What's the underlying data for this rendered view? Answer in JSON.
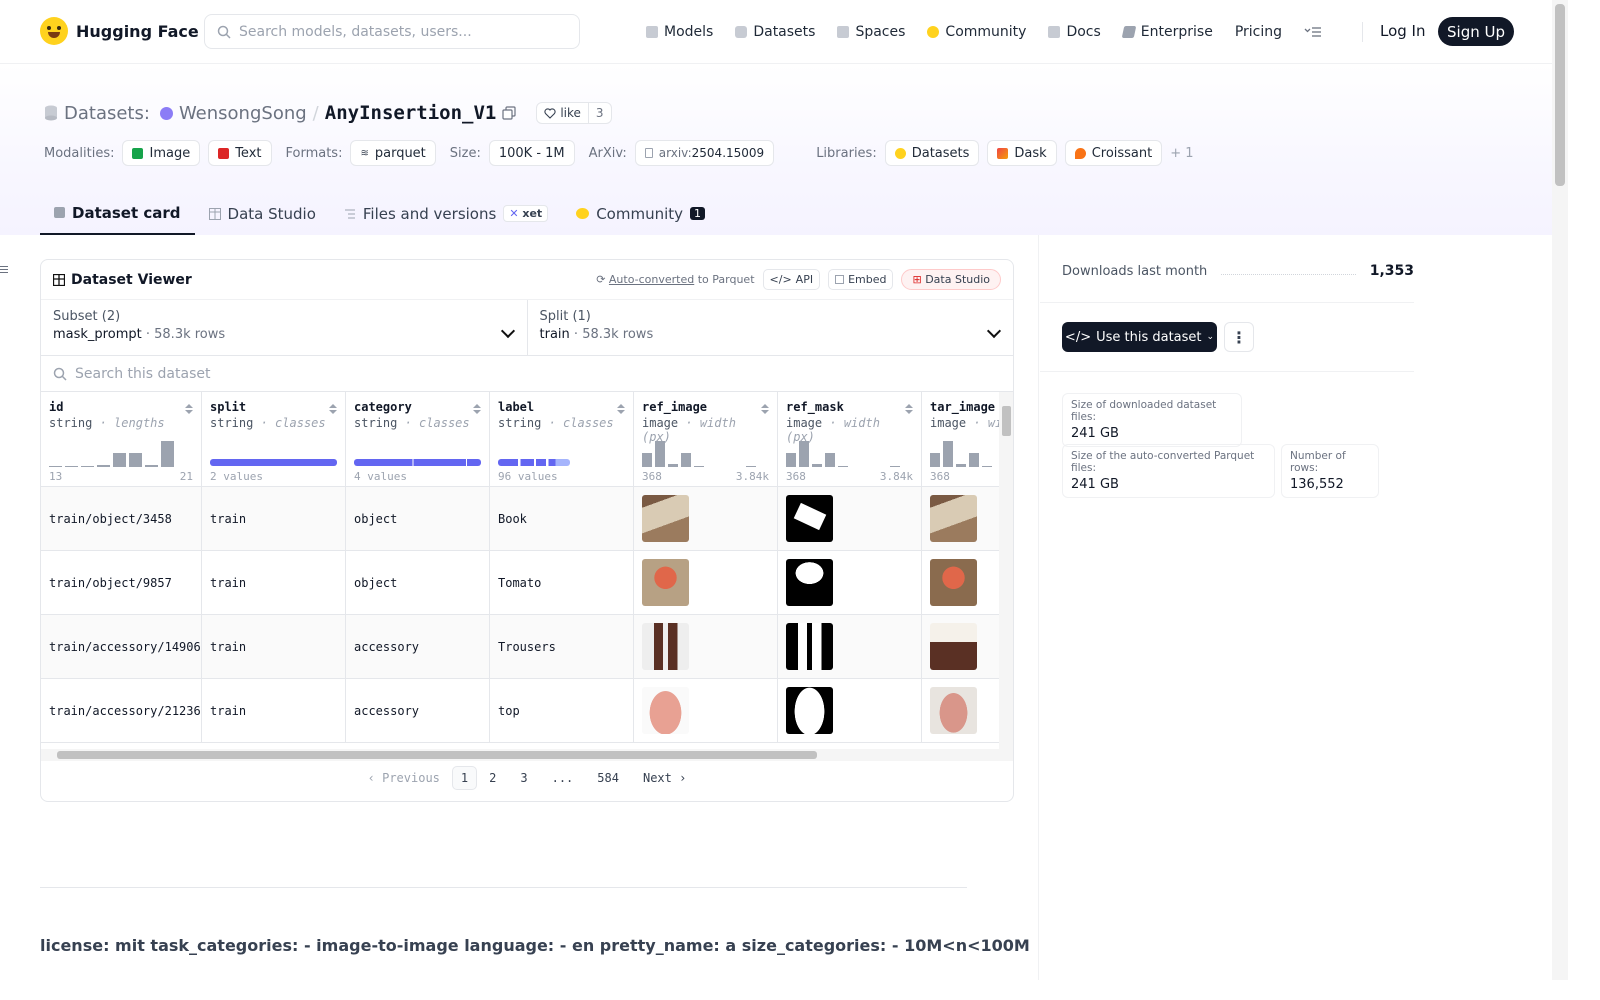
{
  "nav": {
    "brand": "Hugging Face",
    "search_placeholder": "Search models, datasets, users...",
    "items": [
      "Models",
      "Datasets",
      "Spaces",
      "Community",
      "Docs",
      "Enterprise",
      "Pricing"
    ],
    "login": "Log In",
    "signup": "Sign Up"
  },
  "header": {
    "prefix": "Datasets:",
    "owner": "WensongSong",
    "sep": "/",
    "name": "AnyInsertion_V1",
    "like_label": "like",
    "like_count": "3",
    "modalities_label": "Modalities:",
    "modalities": [
      "Image",
      "Text"
    ],
    "formats_label": "Formats:",
    "format": "parquet",
    "size_label": "Size:",
    "size": "100K - 1M",
    "arxiv_label": "ArXiv:",
    "arxiv_prefix": "arxiv:",
    "arxiv_id": "2504.15009",
    "libraries_label": "Libraries:",
    "libraries": [
      "Datasets",
      "Dask",
      "Croissant"
    ],
    "libraries_more": "+ 1"
  },
  "tabs": {
    "card": "Dataset card",
    "studio": "Data Studio",
    "files": "Files and versions",
    "xet": "xet",
    "community": "Community",
    "community_count": "1"
  },
  "viewer": {
    "title": "Dataset Viewer",
    "auto_converted": "Auto-converted",
    "to_parquet": "to Parquet",
    "api": "API",
    "embed": "Embed",
    "studio": "Data Studio",
    "subset_label": "Subset (2)",
    "subset_value": "mask_prompt",
    "subset_rows": "58.3k rows",
    "split_label": "Split (1)",
    "split_value": "train",
    "split_rows": "58.3k rows",
    "search_placeholder": "Search this dataset",
    "columns": [
      {
        "name": "id",
        "type": "string",
        "stat": "lengths",
        "min": "13",
        "max": "21"
      },
      {
        "name": "split",
        "type": "string",
        "stat": "classes",
        "values": "2 values"
      },
      {
        "name": "category",
        "type": "string",
        "stat": "classes",
        "values": "4 values"
      },
      {
        "name": "label",
        "type": "string",
        "stat": "classes",
        "values": "96 values"
      },
      {
        "name": "ref_image",
        "type": "image",
        "stat": "width (px)",
        "min": "368",
        "max": "3.84k"
      },
      {
        "name": "ref_mask",
        "type": "image",
        "stat": "width (px)",
        "min": "368",
        "max": "3.84k"
      },
      {
        "name": "tar_image",
        "type": "image",
        "stat": "wid",
        "min": "368",
        "max": ""
      }
    ],
    "rows": [
      {
        "id": "train/object/3458",
        "split": "train",
        "category": "object",
        "label": "Book"
      },
      {
        "id": "train/object/9857",
        "split": "train",
        "category": "object",
        "label": "Tomato"
      },
      {
        "id": "train/accessory/14906",
        "split": "train",
        "category": "accessory",
        "label": "Trousers"
      },
      {
        "id": "train/accessory/21236",
        "split": "train",
        "category": "accessory",
        "label": "top"
      }
    ],
    "pager": {
      "prev": "Previous",
      "pages": [
        "1",
        "2",
        "3",
        "...",
        "584"
      ],
      "next": "Next"
    }
  },
  "card_yaml": "license: mit task_categories: - image-to-image language: - en pretty_name: a size_categories: - 10M<n<100M",
  "sidebar": {
    "downloads_label": "Downloads last month",
    "downloads": "1,353",
    "use_button": "Use this dataset",
    "stat1_label": "Size of downloaded dataset files:",
    "stat1": "241 GB",
    "stat2_label": "Size of the auto-converted Parquet files:",
    "stat2": "241 GB",
    "stat3_label": "Number of rows:",
    "stat3": "136,552"
  }
}
